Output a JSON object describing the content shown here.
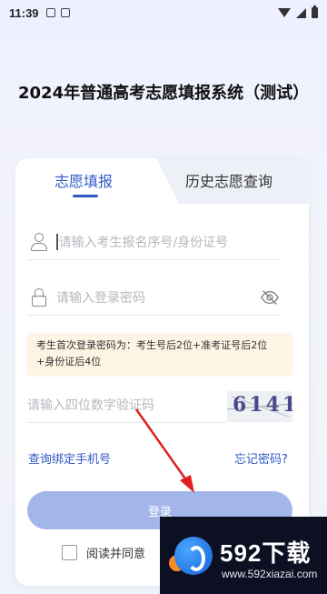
{
  "status_bar": {
    "time": "11:39"
  },
  "header": {
    "title": "2024年普通高考志愿填报系统（测试）"
  },
  "tabs": [
    {
      "label": "志愿填报",
      "active": true
    },
    {
      "label": "历史志愿查询",
      "active": false
    }
  ],
  "form": {
    "id_placeholder": "请输入考生报名序号/身份证号",
    "password_placeholder": "请输入登录密码",
    "notice": "考生首次登录密码为：考生号后2位+准考证号后2位+身份证后4位",
    "captcha_placeholder": "请输入四位数字验证码",
    "captcha_text": "6141"
  },
  "links": {
    "bind_phone": "查询绑定手机号",
    "forgot_password": "忘记密码?"
  },
  "login_button": "登录",
  "agreement": {
    "text": "阅读并同意"
  },
  "watermark": {
    "brand": "592下载",
    "url": "www.592xiazai.com"
  },
  "colors": {
    "accent": "#2f58c4",
    "button": "#a3b6ea",
    "notice_bg": "#fdf4e3",
    "annotation_arrow": "#e02020"
  },
  "icons": [
    "user-icon",
    "lock-icon",
    "eye-off-icon",
    "checkbox-icon",
    "wifi-icon",
    "signal-icon",
    "battery-icon"
  ]
}
